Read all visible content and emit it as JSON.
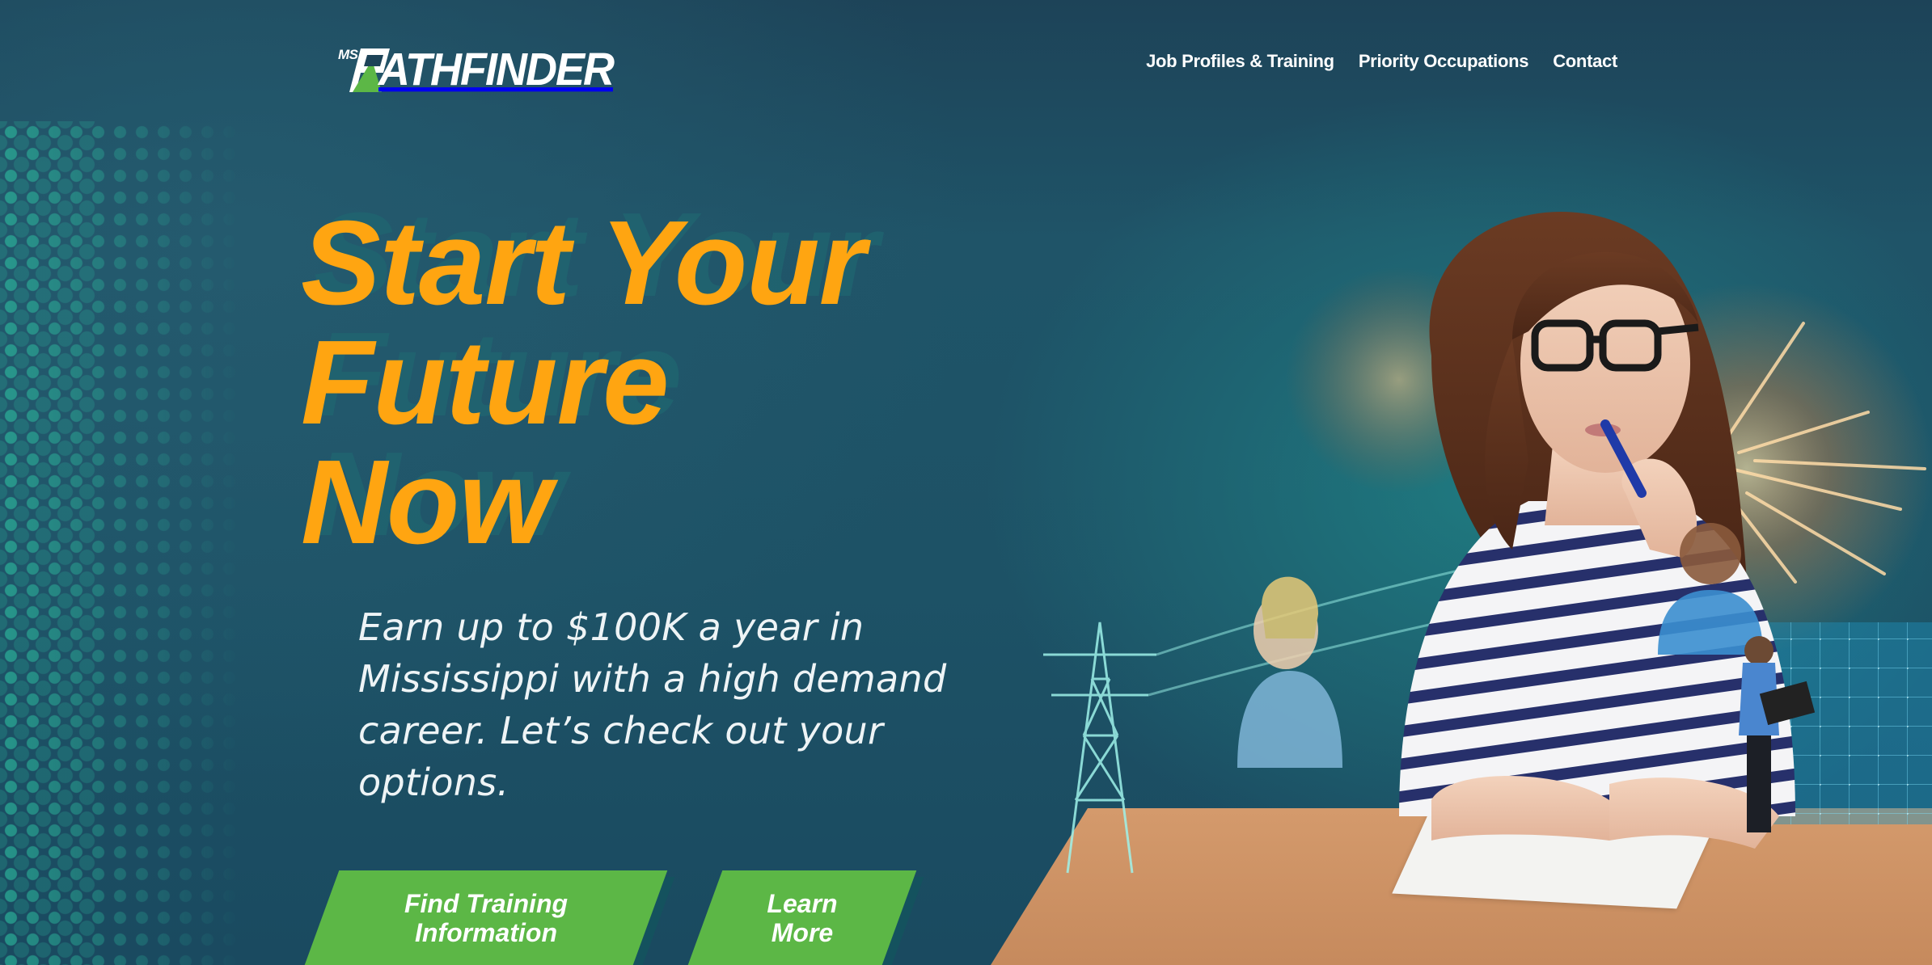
{
  "header": {
    "logo": {
      "prefix": "MS",
      "letter_p": "P",
      "text": "ATHFINDER",
      "accent_color": "#5cb746"
    },
    "nav": [
      {
        "label": "Job Profiles & Training"
      },
      {
        "label": "Priority Occupations"
      },
      {
        "label": "Contact"
      }
    ]
  },
  "hero": {
    "title_lines": [
      "Start Your",
      "Future",
      "Now"
    ],
    "title_color": "#ffa511",
    "subtitle": "Earn up to $100K a year in Mississippi with a high demand career. Let’s check out your options.",
    "buttons": [
      {
        "label": "Find Training\nInformation"
      },
      {
        "label": "Learn\nMore"
      }
    ],
    "button_color": "#5cb746"
  },
  "colors": {
    "background": "#1d5266",
    "dots": "#2dbea0"
  }
}
